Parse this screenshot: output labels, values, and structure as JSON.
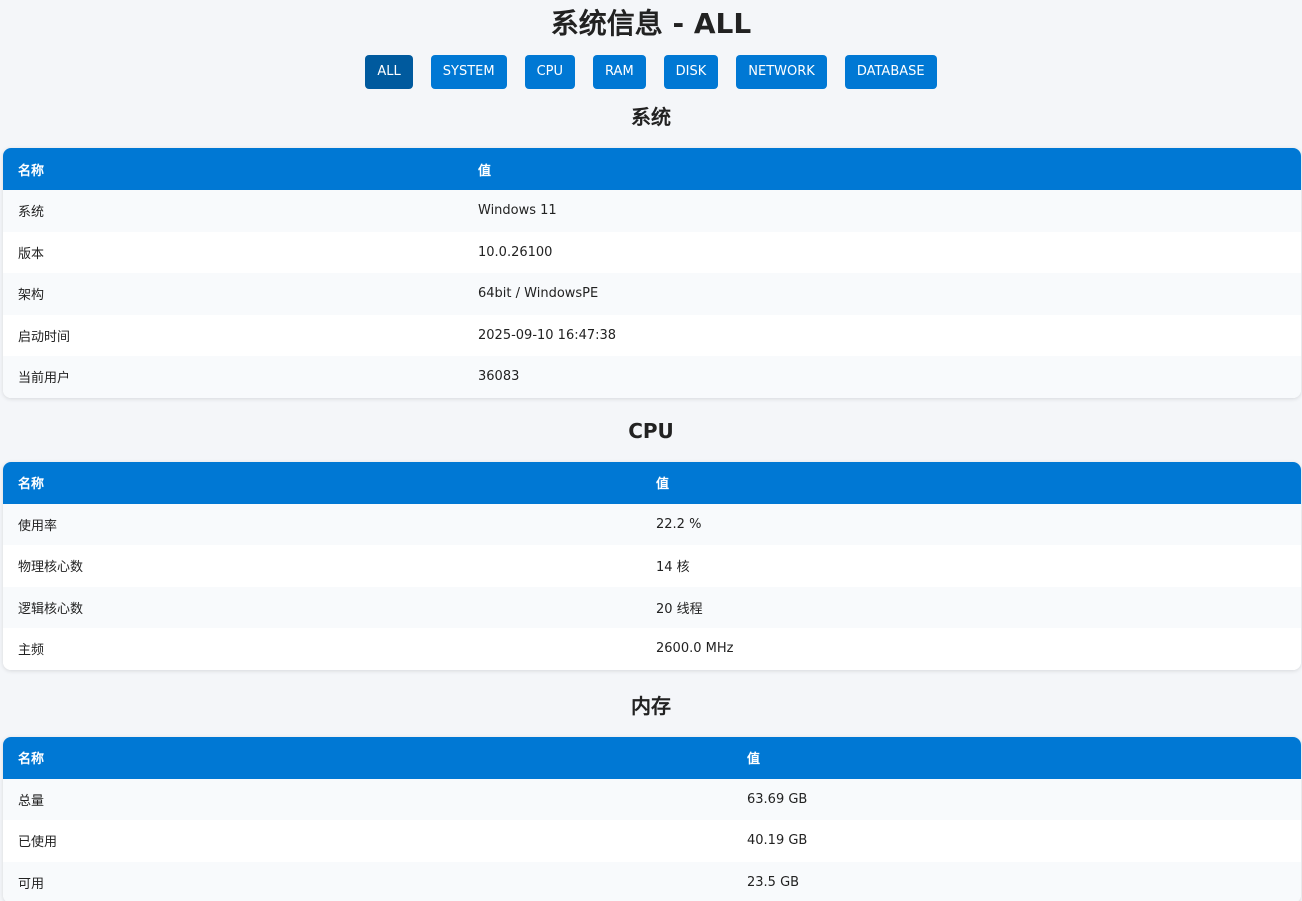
{
  "page": {
    "title": "系统信息 - ALL"
  },
  "nav": {
    "buttons": [
      "ALL",
      "SYSTEM",
      "CPU",
      "RAM",
      "DISK",
      "NETWORK",
      "DATABASE"
    ],
    "active": "ALL"
  },
  "colors": {
    "accent": "#0078d4",
    "accent_active": "#005a9e",
    "background": "#f4f6f9"
  },
  "sections": [
    {
      "title": "系统",
      "headers": [
        "名称",
        "值"
      ],
      "rows": [
        [
          "系统",
          "Windows 11"
        ],
        [
          "版本",
          "10.0.26100"
        ],
        [
          "架构",
          "64bit / WindowsPE"
        ],
        [
          "启动时间",
          "2025-09-10 16:47:38"
        ],
        [
          "当前用户",
          "36083"
        ]
      ]
    },
    {
      "title": "CPU",
      "headers": [
        "名称",
        "值"
      ],
      "rows": [
        [
          "使用率",
          "22.2 %"
        ],
        [
          "物理核心数",
          "14 核"
        ],
        [
          "逻辑核心数",
          "20 线程"
        ],
        [
          "主频",
          "2600.0 MHz"
        ]
      ]
    },
    {
      "title": "内存",
      "headers": [
        "名称",
        "值"
      ],
      "rows": [
        [
          "总量",
          "63.69 GB"
        ],
        [
          "已使用",
          "40.19 GB"
        ],
        [
          "可用",
          "23.5 GB"
        ]
      ]
    }
  ]
}
